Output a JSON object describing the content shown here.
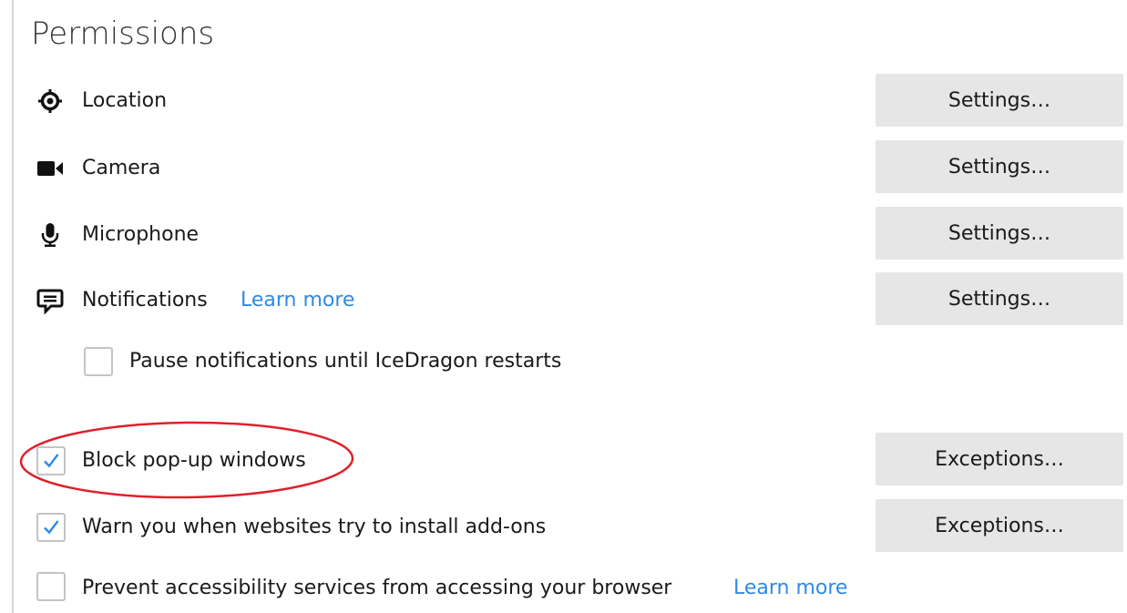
{
  "section_title": "Permissions",
  "permissions": [
    {
      "label": "Location",
      "icon": "location-icon",
      "button": "Settings…"
    },
    {
      "label": "Camera",
      "icon": "camera-icon",
      "button": "Settings…"
    },
    {
      "label": "Microphone",
      "icon": "microphone-icon",
      "button": "Settings…"
    },
    {
      "label": "Notifications",
      "icon": "notifications-icon",
      "learn_more": "Learn more",
      "button": "Settings…"
    }
  ],
  "pause_notifications": {
    "label": "Pause notifications until IceDragon restarts",
    "checked": false
  },
  "block_popups": {
    "label": "Block pop-up windows",
    "checked": true,
    "button": "Exceptions…"
  },
  "warn_addons": {
    "label": "Warn you when websites try to install add-ons",
    "checked": true,
    "button": "Exceptions…"
  },
  "prevent_accessibility": {
    "label": "Prevent accessibility services from accessing your browser",
    "checked": false,
    "learn_more": "Learn more"
  },
  "colors": {
    "link": "#2e8ae6",
    "checkmark": "#2e8ae6",
    "button_bg": "#e6e6e6",
    "annotation": "#e0202a"
  }
}
